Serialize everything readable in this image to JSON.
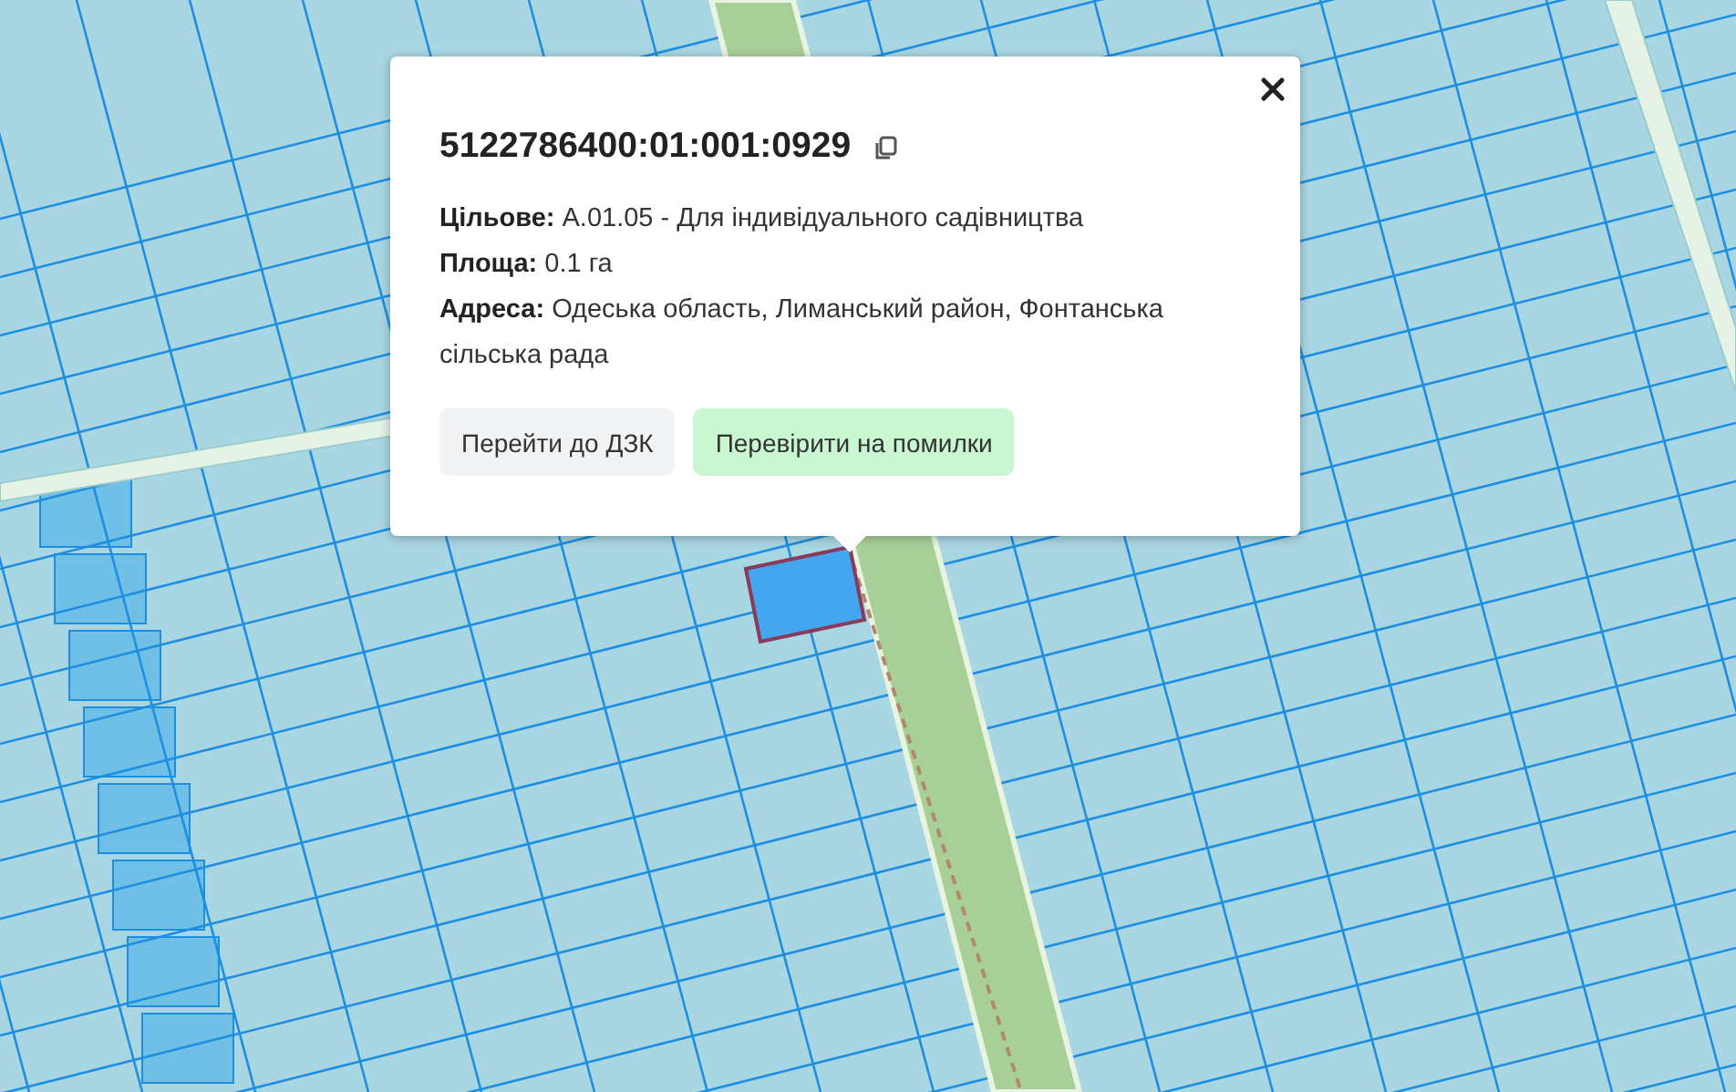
{
  "popup": {
    "title": "5122786400:01:001:0929",
    "fields": [
      "**Цільове:** А.01.05 - Для індивідуального садівництва",
      "**Площа:** 0.1 га",
      "**Адреса:** Одеська область, Лиманський район, Фонтанська сільська рада"
    ],
    "buttons": [
      {
        "label": "Перейти до ДЗК",
        "kind": "neutral"
      },
      {
        "label": "Перевірити на помилки",
        "kind": "success"
      }
    ]
  }
}
